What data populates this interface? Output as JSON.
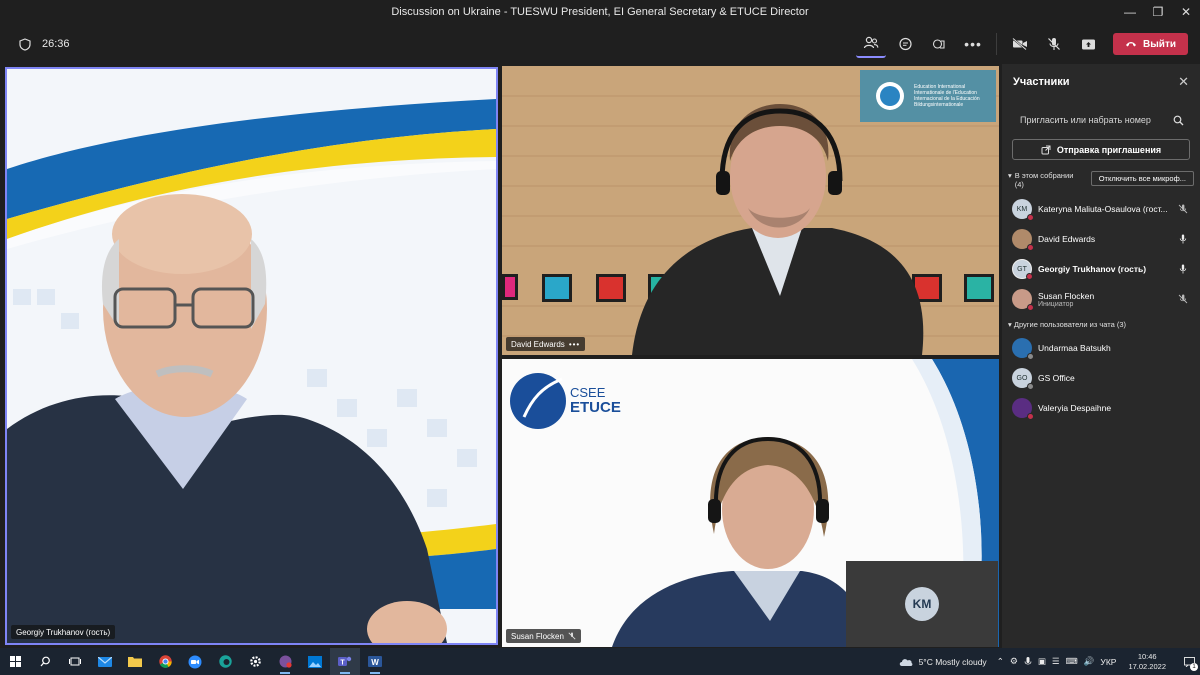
{
  "window": {
    "title": "Discussion on Ukraine - TUESWU President, EI General Secretary & ETUCE Director"
  },
  "toolbar": {
    "timer": "26:36",
    "leave_label": "Выйти"
  },
  "stage": {
    "main_tile": {
      "name": "Georgiy Trukhanov (гость)"
    },
    "top_tile": {
      "name": "David Edwards",
      "badge": "Education International\nInternationale de l'Education\nInternacional de la Educación\nBildungsinternationale"
    },
    "bottom_tile": {
      "name": "Susan Flocken",
      "logo_top": "CSEE",
      "logo_bottom": "ETUCE"
    },
    "self_preview": {
      "initials": "KM"
    }
  },
  "panel": {
    "title": "Участники",
    "search_placeholder": "Пригласить или набрать номер",
    "invite_label": "Отправка приглашения",
    "in_meeting_label": "В этом собрании",
    "in_meeting_count": "(4)",
    "mute_all_label": "Отключить все микроф...",
    "in_meeting": [
      {
        "initials": "KM",
        "name": "Kateryna Maliuta-Osaulova (гост...",
        "sub": "",
        "muted": true,
        "avatar_color": "#c9d3de",
        "dot_color": "#c4314b"
      },
      {
        "initials": "",
        "name": "David Edwards",
        "sub": "",
        "muted": false,
        "avatar_color": "#b08a6a",
        "dot_color": "#c4314b"
      },
      {
        "initials": "GT",
        "name": "Georgiy Trukhanov (гость)",
        "sub": "",
        "muted": false,
        "avatar_color": "#c9d3de",
        "dot_color": "#c4314b"
      },
      {
        "initials": "",
        "name": "Susan Flocken",
        "sub": "Инициатор",
        "muted": true,
        "avatar_color": "#c89a88",
        "dot_color": "#c4314b"
      }
    ],
    "others_label": "Другие пользователи из чата (3)",
    "others": [
      {
        "initials": "",
        "name": "Undarmaa Batsukh",
        "avatar_color": "#2a6fb0",
        "dot_color": "#8a8a8a"
      },
      {
        "initials": "GO",
        "name": "GS Office",
        "avatar_color": "#c9d3de",
        "dot_color": "#8a8a8a"
      },
      {
        "initials": "",
        "name": "Valeryia Despaihne",
        "avatar_color": "#5a2d82",
        "dot_color": "#c4314b"
      }
    ]
  },
  "taskbar": {
    "weather": "5°C  Mostly cloudy",
    "lang": "УКР",
    "time": "10:46",
    "date": "17.02.2022",
    "notifications": "1"
  }
}
